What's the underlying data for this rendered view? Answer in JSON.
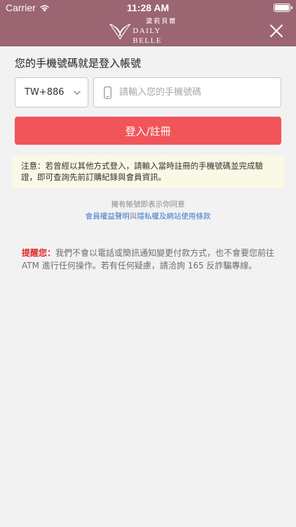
{
  "status_bar": {
    "carrier": "Carrier",
    "time": "11:28 AM"
  },
  "nav": {
    "logo_cn": "黛莉貝爾",
    "logo_en": "DAILY BELLE",
    "icons": {
      "close": "close-icon",
      "logo": "logo-icon"
    }
  },
  "login": {
    "heading": "您的手機號碼就是登入帳號",
    "country_code": "TW+886",
    "phone_placeholder": "請輸入您的手機號碼",
    "phone_value": "",
    "submit_label": "登入/註冊"
  },
  "notice": {
    "text": "注意：若曾經以其他方式登入，請輸入當時註冊的手機號碼並完成驗證，即可查詢先前訂購紀錄與會員資訊。"
  },
  "agreement": {
    "prefix": "擁有帳號即表示你同意",
    "link1": "會員權益聲明",
    "conjunction": "與",
    "link2": "隱私權及網站使用條款"
  },
  "warning": {
    "label": "提醒您：",
    "text": "我們不會以電話或簡訊通知變更付款方式，也不會要您前往 ATM 進行任何操作。若有任何疑慮，請洽詢 165 反詐騙專線。"
  },
  "colors": {
    "brand": "#9b6572",
    "primary_button": "#f1555a",
    "link": "#3d78c8",
    "warning_label": "#e22b2b",
    "notice_bg": "#fbf9e6"
  }
}
